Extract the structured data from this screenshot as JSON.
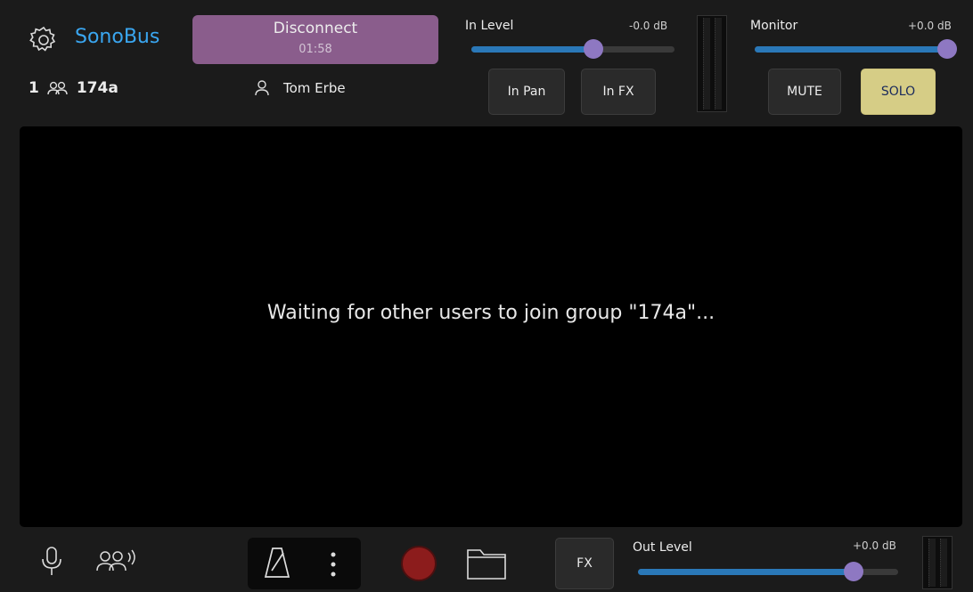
{
  "app": {
    "name": "SonoBus"
  },
  "header": {
    "user_count": "1",
    "group_name": "174a",
    "disconnect_label": "Disconnect",
    "elapsed": "01:58",
    "user_name": "Tom Erbe"
  },
  "in_level": {
    "label": "In Level",
    "db": "-0.0 dB",
    "level": 0.6
  },
  "monitor": {
    "label": "Monitor",
    "db": "+0.0 dB",
    "level": 1.0
  },
  "buttons": {
    "in_pan": "In Pan",
    "in_fx": "In FX",
    "mute": "MUTE",
    "solo": "SOLO"
  },
  "main": {
    "status_message": "Waiting for other users to join group \"174a\"..."
  },
  "footer": {
    "fx_label": "FX",
    "out_level": {
      "label": "Out Level",
      "db": "+0.0 dB",
      "level": 0.83
    }
  },
  "colors": {
    "brand": "#3aa6f0",
    "disconnect": "#8a5d8c",
    "solo_active": "#d6cd86",
    "slider_fill": "#2a78b8",
    "slider_knob": "#8e78c2",
    "record": "#8c1c1c"
  },
  "icons": [
    "settings-gear-icon",
    "users-icon",
    "user-icon",
    "microphone-icon",
    "group-chat-icon",
    "metronome-icon",
    "more-vertical-icon",
    "record-icon",
    "folder-icon"
  ]
}
